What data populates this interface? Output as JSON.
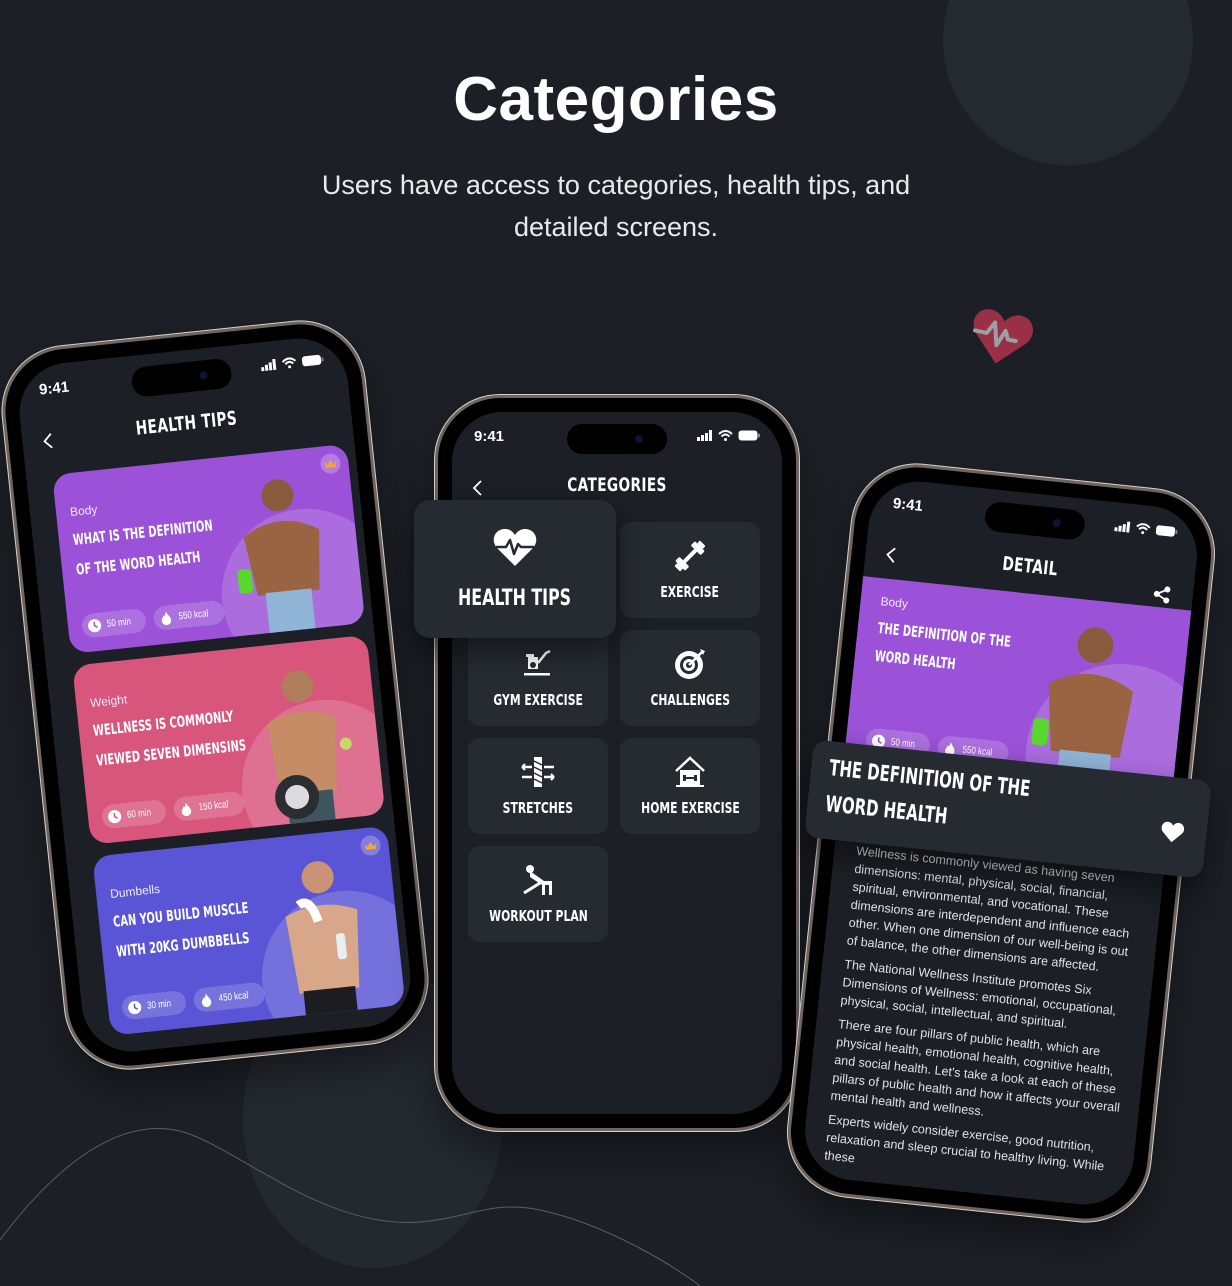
{
  "hero": {
    "title": "Categories",
    "subtitle": "Users have access to categories, health tips, and detailed screens."
  },
  "colors": {
    "background": "#1c2026",
    "tile": "#262b32",
    "body_purple": "#9b52d8",
    "weight_pink": "#d8557c",
    "dumbells_blue": "#5a55d6",
    "heart_red": "#c93a4f",
    "crown_orange": "#f2a531"
  },
  "status_bar": {
    "time": "9:41",
    "icons": [
      "signal-icon",
      "wifi-icon",
      "battery-icon"
    ]
  },
  "health_tips_screen": {
    "title": "HEALTH TIPS",
    "back_icon": "chevron-left-icon",
    "cards": [
      {
        "category": "Body",
        "headline": "WHAT IS THE DEFINITION\nOF THE WORD HEALTH",
        "duration": "50 min",
        "calories": "550 kcal",
        "premium": true,
        "color": "#9b52d8"
      },
      {
        "category": "Weight",
        "headline": "WELLNESS IS COMMONLY\nVIEWED SEVEN DIMENSINS",
        "duration": "60 min",
        "calories": "150 kcal",
        "premium": false,
        "color": "#d8557c"
      },
      {
        "category": "Dumbells",
        "headline": "CAN YOU BUILD MUSCLE\nWITH 20KG DUMBBELLS",
        "duration": "30 min",
        "calories": "450 kcal",
        "premium": true,
        "color": "#5a55d6"
      }
    ]
  },
  "categories_screen": {
    "title": "CATEGORIES",
    "back_icon": "chevron-left-icon",
    "featured": {
      "label": "HEALTH TIPS",
      "icon": "heart-pulse-icon"
    },
    "items": [
      {
        "label": "EXERCISE",
        "icon": "dumbbell-icon"
      },
      {
        "label": "GYM EXERCISE",
        "icon": "exercise-bike-icon"
      },
      {
        "label": "CHALLENGES",
        "icon": "target-icon"
      },
      {
        "label": "STRETCHES",
        "icon": "stretch-icon"
      },
      {
        "label": "HOME EXERCISE",
        "icon": "home-workout-icon"
      },
      {
        "label": "WORKOUT PLAN",
        "icon": "bench-press-icon"
      }
    ]
  },
  "detail_screen": {
    "title": "DETAIL",
    "back_icon": "chevron-left-icon",
    "share_icon": "share-icon",
    "category": "Body",
    "hero_headline": "THE DEFINITION OF THE\nWORD HEALTH",
    "duration": "50 min",
    "calories": "550 kcal",
    "card_headline": "THE DEFINITION OF THE\nWORD HEALTH",
    "favorite_icon": "heart-icon",
    "paragraphs": [
      "Wellness is commonly viewed as having seven dimensions: mental, physical, social, financial, spiritual, environmental, and vocational. These dimensions are interdependent and influence each other. When one dimension of our well-being is out of balance, the other dimensions are affected.",
      "The National Wellness Institute promotes Six Dimensions of Wellness: emotional, occupational, physical, social, intellectual, and spiritual.",
      "There are four pillars of public health, which are physical health, emotional health, cognitive health, and social health. Let's take a look at each of these pillars of public health and how it affects your overall mental health and wellness.",
      "Experts widely consider exercise, good nutrition, relaxation and sleep crucial to healthy living. While these"
    ]
  }
}
